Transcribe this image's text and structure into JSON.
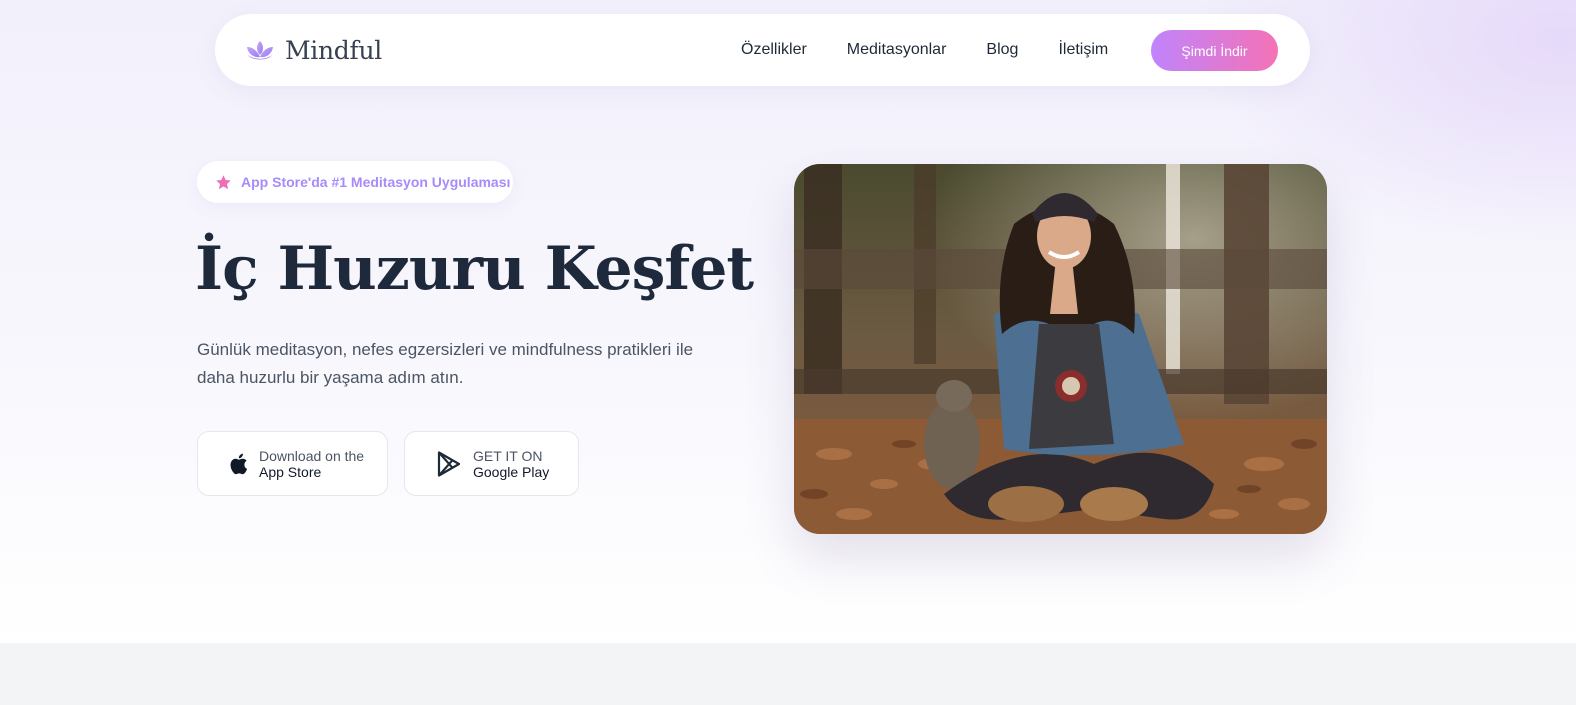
{
  "brand": {
    "name": "Mindful",
    "logo_icon": "lotus-icon"
  },
  "nav": {
    "links": [
      "Özellikler",
      "Meditasyonlar",
      "Blog",
      "İletişim"
    ],
    "cta_label": "Şimdi İndir"
  },
  "hero": {
    "badge": {
      "icon": "star-icon",
      "text": "App Store'da #1 Meditasyon Uygulaması"
    },
    "title": "İç Huzuru Keşfet",
    "description": "Günlük meditasyon, nefes egzersizleri ve mindfulness pratikleri ile daha huzurlu bir yaşama adım atın.",
    "store_buttons": {
      "apple": {
        "icon": "apple-icon",
        "small": "Download on the",
        "big": "App Store"
      },
      "google": {
        "icon": "google-play-icon",
        "small": "GET IT ON",
        "big": "Google Play"
      }
    },
    "image": {
      "alt": "woman-meditating-in-autumn-forest"
    }
  },
  "colors": {
    "accent_start": "#c084fc",
    "accent_end": "#f472b6",
    "badge_text": "#a78bfa",
    "title": "#1e293b",
    "text_muted": "#4b5563"
  }
}
